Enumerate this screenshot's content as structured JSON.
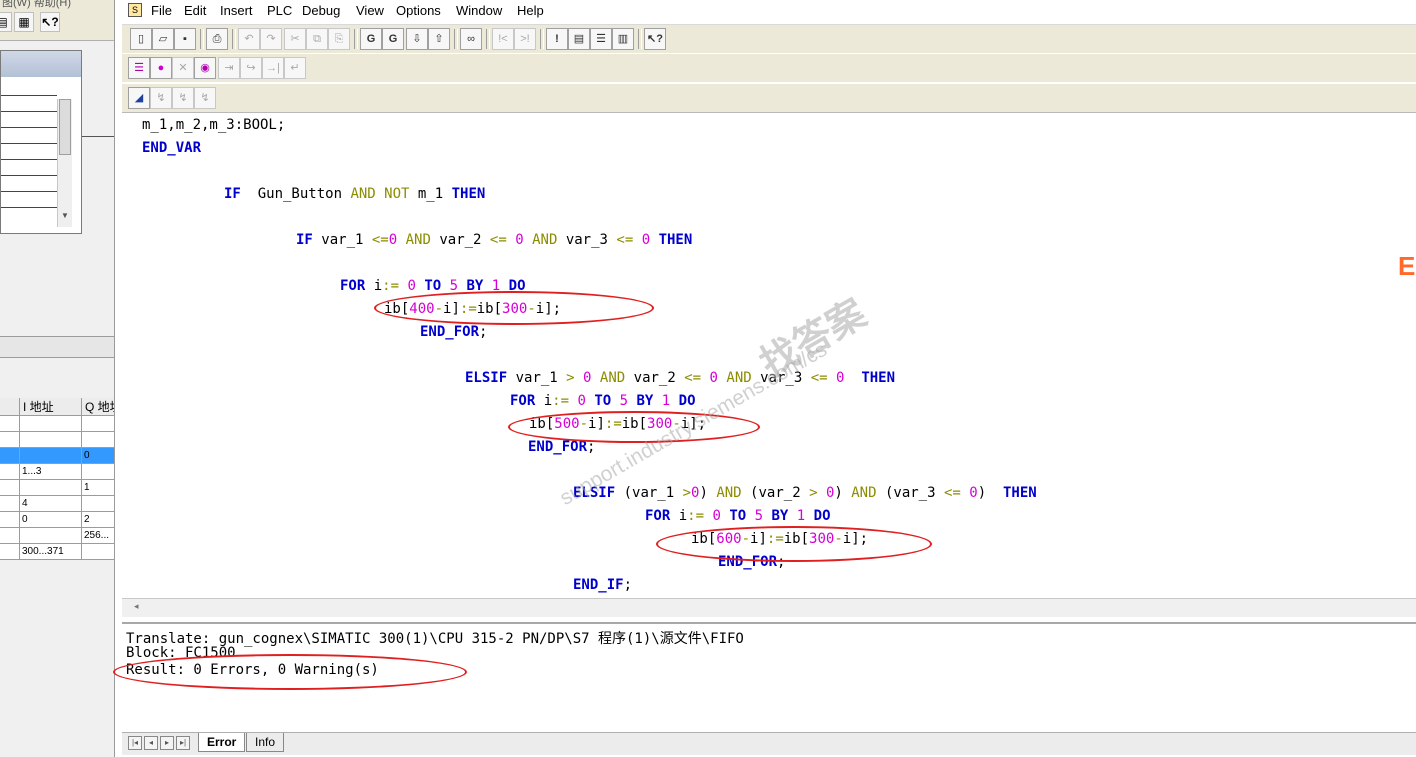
{
  "left_pane": {
    "toolbar_partial": "图(W)     帮助(H)",
    "hw_table": {
      "headers": [
        "",
        "I 地址",
        "Q 地址"
      ],
      "rows": [
        [
          "",
          "",
          ""
        ],
        [
          "",
          "",
          ""
        ],
        [
          "",
          "",
          "0"
        ],
        [
          "",
          "1...3",
          ""
        ],
        [
          "",
          "",
          "1"
        ],
        [
          "",
          "4",
          ""
        ],
        [
          "",
          "0",
          "2"
        ],
        [
          "",
          "",
          "256..."
        ],
        [
          "",
          "300...371",
          ""
        ]
      ]
    }
  },
  "menu": [
    "File",
    "Edit",
    "Insert",
    "PLC",
    "Debug",
    "View",
    "Options",
    "Window",
    "Help"
  ],
  "toolbar1": [
    "new-icon",
    "open-icon",
    "save-icon",
    "print-icon",
    "undo-icon",
    "redo-icon",
    "cut-icon",
    "copy-icon",
    "paste-icon",
    "compile-icon",
    "compile-all-icon",
    "download-icon",
    "upload-icon",
    "monitor-icon",
    "breakpoint-prev-icon",
    "breakpoint-next-icon",
    "exclamation-icon",
    "window-cascade-icon",
    "window-tile-h-icon",
    "window-tile-v-icon",
    "help-pointer-icon"
  ],
  "toolbar2": [
    "list-icon",
    "record-icon",
    "disconnect-icon",
    "run-icon",
    "step-icon",
    "step-over-icon",
    "step-into-icon",
    "step-out-icon"
  ],
  "toolbar3": [
    "monitor-cycle-icon",
    "trace-icon",
    "trace-off-icon"
  ],
  "code": {
    "lines": [
      [
        [
          "t",
          "m_1,m_2,m_3:BOOL;"
        ]
      ],
      [
        [
          "kw",
          "END_VAR"
        ]
      ],
      [],
      [
        [
          "kw",
          "IF"
        ],
        [
          "t",
          "  Gun_Button "
        ],
        [
          "op",
          "AND NOT"
        ],
        [
          "t",
          " m_1 "
        ],
        [
          "kw",
          "THEN"
        ]
      ],
      [],
      [
        [
          "kw",
          "IF"
        ],
        [
          "t",
          " var_1 "
        ],
        [
          "op",
          "<="
        ],
        [
          "num",
          "0"
        ],
        [
          "t",
          " "
        ],
        [
          "op",
          "AND"
        ],
        [
          "t",
          " var_2 "
        ],
        [
          "op",
          "<="
        ],
        [
          "t",
          " "
        ],
        [
          "num",
          "0"
        ],
        [
          "t",
          " "
        ],
        [
          "op",
          "AND"
        ],
        [
          "t",
          " var_3 "
        ],
        [
          "op",
          "<="
        ],
        [
          "t",
          " "
        ],
        [
          "num",
          "0"
        ],
        [
          "t",
          " "
        ],
        [
          "kw",
          "THEN"
        ]
      ],
      [],
      [
        [
          "kw",
          "FOR"
        ],
        [
          "t",
          " i"
        ],
        [
          "op",
          ":="
        ],
        [
          "t",
          " "
        ],
        [
          "num",
          "0"
        ],
        [
          "t",
          " "
        ],
        [
          "kw",
          "TO"
        ],
        [
          "t",
          " "
        ],
        [
          "num",
          "5"
        ],
        [
          "t",
          " "
        ],
        [
          "kw",
          "BY"
        ],
        [
          "t",
          " "
        ],
        [
          "num",
          "1"
        ],
        [
          "t",
          " "
        ],
        [
          "kw",
          "DO"
        ]
      ],
      [
        [
          "t",
          "ib["
        ],
        [
          "num",
          "400"
        ],
        [
          "op",
          "-"
        ],
        [
          "t",
          "i]"
        ],
        [
          "op",
          ":="
        ],
        [
          "t",
          "ib["
        ],
        [
          "num",
          "300"
        ],
        [
          "op",
          "-"
        ],
        [
          "t",
          "i];"
        ]
      ],
      [
        [
          "kw",
          "END_FOR"
        ],
        [
          "t",
          ";"
        ]
      ],
      [],
      [
        [
          "kw",
          "ELSIF"
        ],
        [
          "t",
          " var_1 "
        ],
        [
          "op",
          ">"
        ],
        [
          "t",
          " "
        ],
        [
          "num",
          "0"
        ],
        [
          "t",
          " "
        ],
        [
          "op",
          "AND"
        ],
        [
          "t",
          " var_2 "
        ],
        [
          "op",
          "<="
        ],
        [
          "t",
          " "
        ],
        [
          "num",
          "0"
        ],
        [
          "t",
          " "
        ],
        [
          "op",
          "AND"
        ],
        [
          "t",
          " var_3 "
        ],
        [
          "op",
          "<="
        ],
        [
          "t",
          " "
        ],
        [
          "num",
          "0"
        ],
        [
          "t",
          "  "
        ],
        [
          "kw",
          "THEN"
        ]
      ],
      [
        [
          "kw",
          "FOR"
        ],
        [
          "t",
          " i"
        ],
        [
          "op",
          ":="
        ],
        [
          "t",
          " "
        ],
        [
          "num",
          "0"
        ],
        [
          "t",
          " "
        ],
        [
          "kw",
          "TO"
        ],
        [
          "t",
          " "
        ],
        [
          "num",
          "5"
        ],
        [
          "t",
          " "
        ],
        [
          "kw",
          "BY"
        ],
        [
          "t",
          " "
        ],
        [
          "num",
          "1"
        ],
        [
          "t",
          " "
        ],
        [
          "kw",
          "DO"
        ]
      ],
      [
        [
          "t",
          "ib["
        ],
        [
          "num",
          "500"
        ],
        [
          "op",
          "-"
        ],
        [
          "t",
          "i]"
        ],
        [
          "op",
          ":="
        ],
        [
          "t",
          "ib["
        ],
        [
          "num",
          "300"
        ],
        [
          "op",
          "-"
        ],
        [
          "t",
          "i];"
        ]
      ],
      [
        [
          "kw",
          "END_FOR"
        ],
        [
          "t",
          ";"
        ]
      ],
      [],
      [
        [
          "kw",
          "ELSIF"
        ],
        [
          "t",
          " (var_1 "
        ],
        [
          "op",
          ">"
        ],
        [
          "num",
          "0"
        ],
        [
          "t",
          ") "
        ],
        [
          "op",
          "AND"
        ],
        [
          "t",
          " (var_2 "
        ],
        [
          "op",
          ">"
        ],
        [
          "t",
          " "
        ],
        [
          "num",
          "0"
        ],
        [
          "t",
          ") "
        ],
        [
          "op",
          "AND"
        ],
        [
          "t",
          " (var_3 "
        ],
        [
          "op",
          "<="
        ],
        [
          "t",
          " "
        ],
        [
          "num",
          "0"
        ],
        [
          "t",
          ")  "
        ],
        [
          "kw",
          "THEN"
        ]
      ],
      [
        [
          "kw",
          "FOR"
        ],
        [
          "t",
          " i"
        ],
        [
          "op",
          ":="
        ],
        [
          "t",
          " "
        ],
        [
          "num",
          "0"
        ],
        [
          "t",
          " "
        ],
        [
          "kw",
          "TO"
        ],
        [
          "t",
          " "
        ],
        [
          "num",
          "5"
        ],
        [
          "t",
          " "
        ],
        [
          "kw",
          "BY"
        ],
        [
          "t",
          " "
        ],
        [
          "num",
          "1"
        ],
        [
          "t",
          " "
        ],
        [
          "kw",
          "DO"
        ]
      ],
      [
        [
          "t",
          "ib["
        ],
        [
          "num",
          "600"
        ],
        [
          "op",
          "-"
        ],
        [
          "t",
          "i]"
        ],
        [
          "op",
          ":="
        ],
        [
          "t",
          "ib["
        ],
        [
          "num",
          "300"
        ],
        [
          "op",
          "-"
        ],
        [
          "t",
          "i];"
        ]
      ],
      [
        [
          "kw",
          "END_FOR"
        ],
        [
          "t",
          ";"
        ]
      ],
      [],
      [
        [
          "kw",
          "END_IF"
        ],
        [
          "t",
          ";"
        ]
      ]
    ]
  },
  "output": {
    "translate": "Translate: gun_cognex\\SIMATIC 300(1)\\CPU 315-2 PN/DP\\S7 程序(1)\\源文件\\FIFO",
    "block": "Block: FC1500",
    "result": "Result: 0 Errors, 0 Warning(s)"
  },
  "output_tabs": [
    "Error",
    "Info"
  ],
  "watermark": {
    "cn": "找答案",
    "url": "support.industry.siemens.com/cs",
    "edge": "E"
  },
  "colors": {
    "keyword": "#0000cc",
    "operator": "#8c8c00",
    "number": "#d400d4",
    "annotation": "#e02020"
  }
}
